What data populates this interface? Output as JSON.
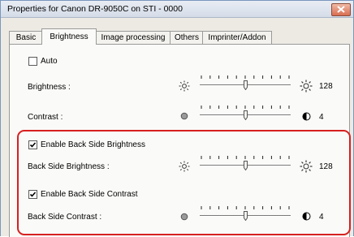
{
  "window": {
    "title": "Properties for Canon DR-9050C on STI - 0000"
  },
  "tabs": [
    {
      "label": "Basic",
      "active": false
    },
    {
      "label": "Brightness",
      "active": true
    },
    {
      "label": "Image processing",
      "active": false
    },
    {
      "label": "Others",
      "active": false
    },
    {
      "label": "Imprinter/Addon",
      "active": false
    }
  ],
  "auto": {
    "label": "Auto",
    "checked": false
  },
  "brightness": {
    "label": "Brightness :",
    "value": "128",
    "min_icon": "sun-dim-icon",
    "max_icon": "sun-bright-icon",
    "fraction": 0.5
  },
  "contrast": {
    "label": "Contrast :",
    "value": "4",
    "min_icon": "contrast-low-icon",
    "max_icon": "contrast-high-icon",
    "fraction": 0.5
  },
  "back_brightness_enable": {
    "label": "Enable Back Side Brightness",
    "checked": true
  },
  "back_brightness": {
    "label": "Back Side Brightness :",
    "value": "128",
    "fraction": 0.5
  },
  "back_contrast_enable": {
    "label": "Enable Back Side Contrast",
    "checked": true
  },
  "back_contrast": {
    "label": "Back Side Contrast :",
    "value": "4",
    "fraction": 0.5
  },
  "colors": {
    "highlight": "#d6201f"
  }
}
